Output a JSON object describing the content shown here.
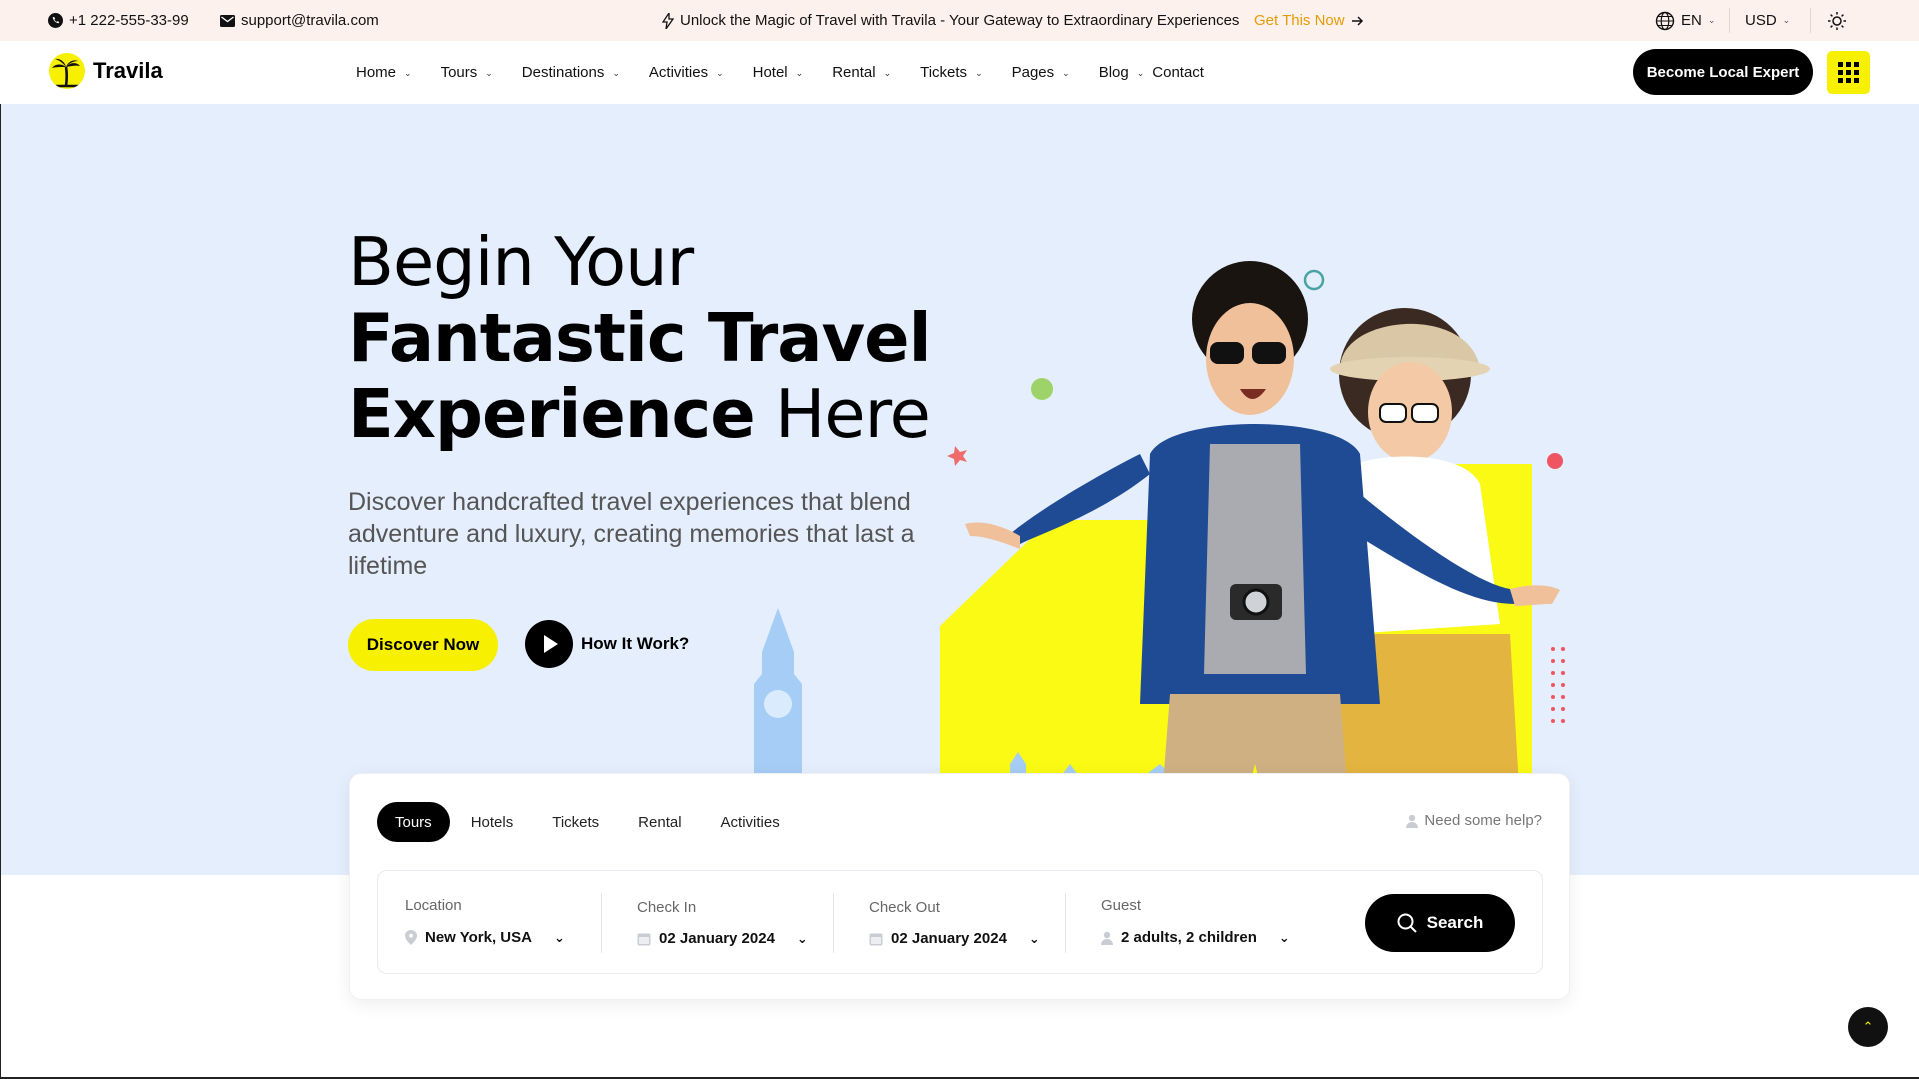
{
  "topbar": {
    "phone": "+1 222-555-33-99",
    "email": "support@travila.com",
    "promo": "Unlock the Magic of Travel with Travila - Your Gateway to Extraordinary Experiences",
    "promo_cta": "Get This Now",
    "language": "EN",
    "currency": "USD"
  },
  "header": {
    "brand": "Travila",
    "nav": [
      {
        "label": "Home"
      },
      {
        "label": "Tours"
      },
      {
        "label": "Destinations"
      },
      {
        "label": "Activities"
      },
      {
        "label": "Hotel"
      },
      {
        "label": "Rental"
      },
      {
        "label": "Tickets"
      },
      {
        "label": "Pages"
      },
      {
        "label": "Blog"
      },
      {
        "label": "Contact"
      }
    ],
    "cta": "Become Local Expert"
  },
  "hero": {
    "title_line1": "Begin Your",
    "title_line2": "Fantastic Travel",
    "title_line3_bold": "Experience",
    "title_line3_light": " Here",
    "subtitle": "Discover handcrafted travel experiences that blend adventure and luxury, creating memories that last a lifetime",
    "primary_button": "Discover Now",
    "secondary_button": "How It Work?"
  },
  "search": {
    "tabs": [
      "Tours",
      "Hotels",
      "Tickets",
      "Rental",
      "Activities"
    ],
    "active_tab": "Tours",
    "help": "Need some help?",
    "location_label": "Location",
    "location_value": "New York, USA",
    "checkin_label": "Check In",
    "checkin_value": "02 January 2024",
    "checkout_label": "Check Out",
    "checkout_value": "02 January 2024",
    "guest_label": "Guest",
    "guest_value": "2 adults, 2 children",
    "button": "Search"
  },
  "colors": {
    "accent": "#f7f000",
    "promo_cta": "#e79a06",
    "hero_bg": "#e4eefd",
    "topbar_bg": "#fdf1ee"
  }
}
